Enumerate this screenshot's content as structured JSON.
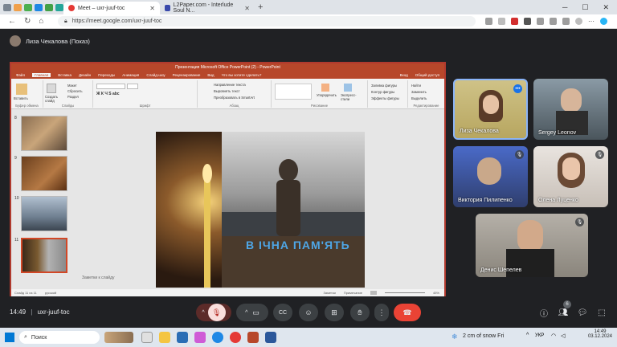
{
  "browser": {
    "tabs": [
      {
        "title": "Meet – uxr-juuf-toc",
        "active": true
      },
      {
        "title": "L2Paper.com - Interlude Soul N...",
        "active": false
      }
    ],
    "new_tab": "+",
    "url": "https://meet.google.com/uxr-juuf-toc"
  },
  "presenter": {
    "label": "Лиза Чекалова (Показ)"
  },
  "powerpoint": {
    "title": "Презентация Microsoft Office PowerPoint (2) - PowerPoint",
    "menu": [
      "Файл",
      "Главная",
      "Вставка",
      "Дизайн",
      "Переходы",
      "Анимация",
      "Слайд-шоу",
      "Рецензирование",
      "Вид",
      "Что вы хотите сделать?"
    ],
    "menu_right": [
      "Вход",
      "Общий доступ"
    ],
    "ribbon": {
      "paste": "Вставить",
      "create_slide": "Создать слайд",
      "cut": "Макет",
      "reset": "Сбросить",
      "section": "Раздел",
      "groups": [
        "Буфер обмена",
        "Слайды",
        "Шрифт",
        "Абзац",
        "Рисование",
        "Редактирование"
      ],
      "text_direction": "Направление текста",
      "align_text": "Выровнять текст",
      "smartart": "Преобразовать в SmartArt",
      "arrange": "Упорядочить",
      "quick_styles": "Экспресс-стили",
      "fill": "Заливка фигуры",
      "outline": "Контур фигуры",
      "effects": "Эффекты фигуры",
      "find": "Найти",
      "replace": "Заменить",
      "select": "Выделить"
    },
    "thumbs": [
      "8",
      "9",
      "10",
      "11"
    ],
    "slide_text": "В ІЧНА ПАМ'ЯТЬ",
    "notes": "Заметки к слайду",
    "status": {
      "slide": "Слайд 11 из 11",
      "lang": "русский",
      "notes": "Заметки",
      "comments": "Примечание",
      "zoom": "45%"
    }
  },
  "participants": [
    {
      "name": "Лиза Чекалова"
    },
    {
      "name": "Sergey Leonov"
    },
    {
      "name": "Виктория Пилипенко"
    },
    {
      "name": "Олена Луценко"
    },
    {
      "name": "Денис Шепелев"
    }
  ],
  "bottombar": {
    "time": "14:49",
    "meeting_code": "uxr-juuf-toc",
    "people_badge": "6"
  },
  "taskbar": {
    "search": "Поиск",
    "weather": "2 cm of snow Fri",
    "lang": "УКР",
    "clock": "14:49",
    "date": "03.12.2024"
  },
  "colors": {
    "meet_bg": "#202124",
    "hangup": "#ea4335",
    "ppt": "#b7472a",
    "highlight": "#8ab4f8"
  }
}
